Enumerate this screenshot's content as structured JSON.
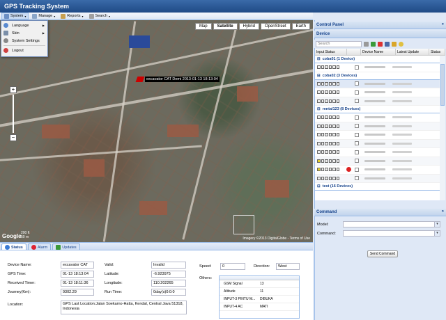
{
  "app": {
    "title": "GPS Tracking System"
  },
  "menubar": {
    "items": [
      {
        "label": "System",
        "icon": "system-icon"
      },
      {
        "label": "Manage",
        "icon": "manage-icon"
      },
      {
        "label": "Reports",
        "icon": "reports-icon"
      },
      {
        "label": "Search",
        "icon": "search-icon"
      }
    ]
  },
  "system_menu": {
    "items": [
      {
        "label": "Language",
        "icon": "language-icon",
        "submenu": true
      },
      {
        "label": "Skin",
        "icon": "skin-icon",
        "submenu": true
      },
      {
        "label": "System Settings",
        "icon": "settings-icon",
        "submenu": false
      },
      {
        "label": "Logout",
        "icon": "logout-icon",
        "submenu": false
      }
    ]
  },
  "map": {
    "types": [
      "Map",
      "Satellite",
      "Hybrid",
      "OpenStreet",
      "Earth"
    ],
    "selected_type": "Satellite",
    "marker_label": "excavator CAT Demi 2013-01-13 18:13:04",
    "scale_top": "200 ft",
    "scale_bottom": "50 m",
    "logo": "Google",
    "copyright": "Imagery ©2013 DigitalGlobe - Terms of Use"
  },
  "tabs": [
    {
      "label": "Status",
      "icon": "status-icon"
    },
    {
      "label": "Alarm",
      "icon": "alarm-icon"
    },
    {
      "label": "Updates",
      "icon": "updates-icon"
    }
  ],
  "status": {
    "device_name_label": "Device Name:",
    "device_name": "excavator CAT",
    "gps_time_label": "GPS Time:",
    "gps_time": "01-13 18:13:04",
    "received_time_label": "Received Timer:",
    "received_time": "01-13 18:11:36",
    "journey_label": "Journey(Km):",
    "journey": "9302.29",
    "valid_label": "Valid:",
    "valid": "Invalid",
    "latitude_label": "Latitude:",
    "latitude": "-6.923975",
    "longitude_label": "Longitude:",
    "longitude": "110.202265",
    "run_time_label": "Run Time:",
    "run_time": "0day(s)0:0:0",
    "speed_label": "Speed:",
    "speed": "0",
    "direction_label": "Direction:",
    "direction": "West",
    "others_label": "Others:",
    "location_label": "Location:",
    "location": "GPS Last Location:Jalan Soekarno-Hatta, Kendal, Central Java 51318, Indonesia",
    "others": [
      {
        "key": "GSM Signal",
        "value": "13"
      },
      {
        "key": "Altitude",
        "value": "11"
      },
      {
        "key": "INPUT-3 PINTU M...",
        "value": "DIBUKA"
      },
      {
        "key": "INPUT-4 AC",
        "value": "MATI"
      }
    ]
  },
  "control_panel": {
    "title": "Control Panel",
    "device_title": "Device",
    "search_placeholder": "Search",
    "columns": [
      "Input Status",
      "Device Name",
      "Latest Update",
      "Status"
    ],
    "groups": [
      {
        "name": "coba01 (1 Device)",
        "rows": 1
      },
      {
        "name": "coba02 (3 Devices)",
        "rows": 3
      },
      {
        "name": "rental123 (8 Devices)",
        "rows": 8
      },
      {
        "name": "test (16 Devices)",
        "rows": 0
      }
    ]
  },
  "command_panel": {
    "title": "Command",
    "model_label": "Model:",
    "command_label": "Command:",
    "send_label": "Send Command"
  },
  "colors": {
    "accent": "#15428b",
    "title_bg": "#1f4a86",
    "panel_bg": "#dfe8f6"
  }
}
